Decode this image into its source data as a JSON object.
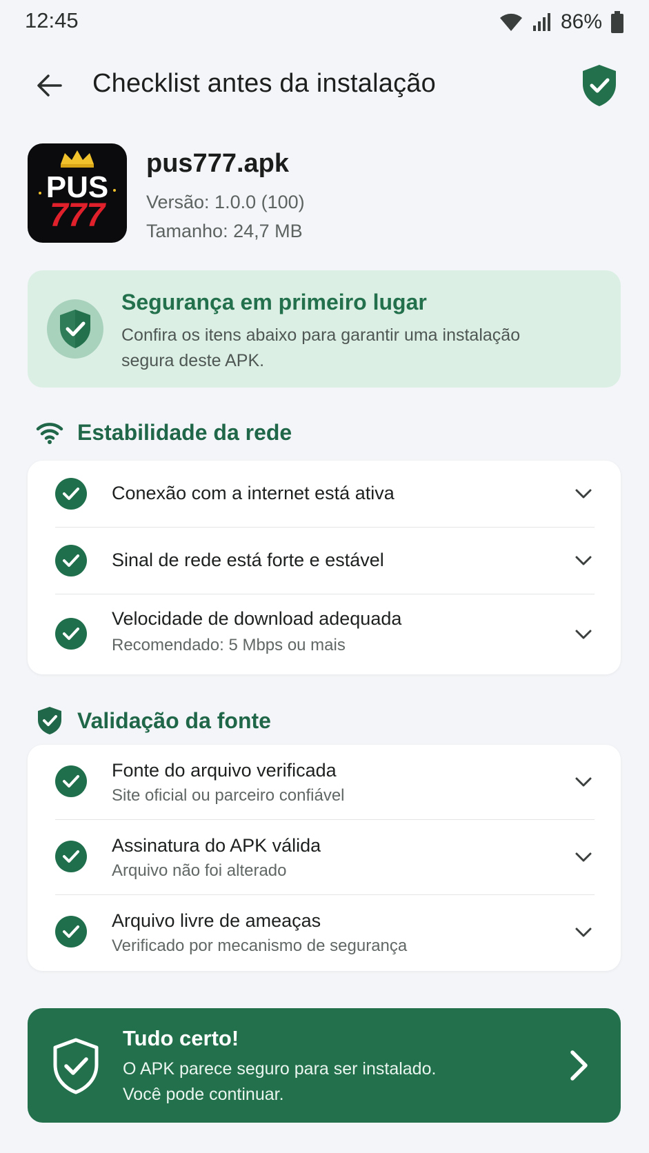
{
  "status_bar": {
    "time": "12:45",
    "battery": "86%",
    "icons": [
      "wifi-icon",
      "signal-icon",
      "battery-icon"
    ]
  },
  "app_bar": {
    "title": "Checklist antes da instalação",
    "back_icon": "arrow-left-icon",
    "trailing_icon": "shield-check-icon"
  },
  "app_info": {
    "icon_line1": "PUS",
    "icon_line2": "777",
    "name": "pus777.apk",
    "version": "Versão: 1.0.0 (100)",
    "size": "Tamanho: 24,7 MB"
  },
  "security_banner": {
    "title": "Segurança em primeiro lugar",
    "text": "Confira os itens abaixo para garantir uma instalação segura deste APK."
  },
  "network_section": {
    "title": "Estabilidade da rede",
    "icon": "wifi-icon",
    "items": [
      {
        "title": "Conexão com a internet está ativa",
        "subtitle": ""
      },
      {
        "title": "Sinal de rede está forte e estável",
        "subtitle": ""
      },
      {
        "title": "Velocidade de download adequada",
        "subtitle": "Recomendado: 5 Mbps ou mais"
      }
    ]
  },
  "source_section": {
    "title": "Validação da fonte",
    "icon": "shield-check-icon",
    "items": [
      {
        "title": "Fonte do arquivo verificada",
        "subtitle": "Site oficial ou parceiro confiável"
      },
      {
        "title": "Assinatura do APK válida",
        "subtitle": "Arquivo não foi alterado"
      },
      {
        "title": "Arquivo livre de ameaças",
        "subtitle": "Verificado por mecanismo de segurança"
      }
    ]
  },
  "final_banner": {
    "title": "Tudo certo!",
    "line1": "O APK parece seguro para ser instalado.",
    "line2": "Você pode continuar."
  },
  "colors": {
    "primary_green": "#22704c",
    "banner_bg": "#dcefe5",
    "background": "#f3f5f8",
    "icon_red": "#e0202a",
    "icon_gold": "#f2c22c"
  }
}
